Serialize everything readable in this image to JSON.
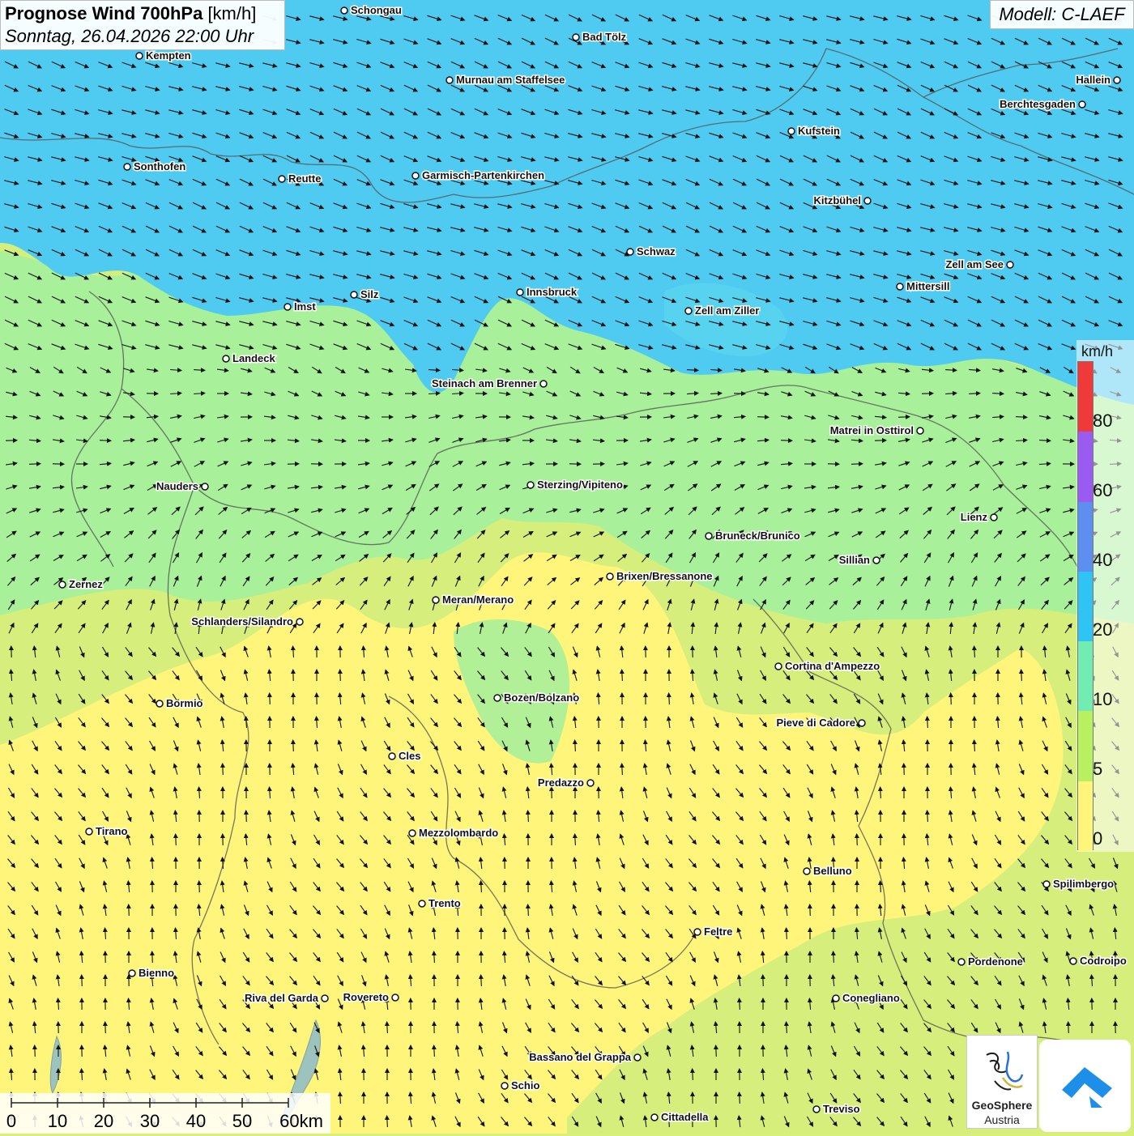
{
  "header": {
    "title": "Prognose Wind 700hPa",
    "unit": "[km/h]",
    "datetime": "Sonntag, 26.04.2026 22:00 Uhr",
    "model": "Modell: C-LAEF"
  },
  "legend": {
    "unit": "km/h",
    "labels": [
      "80",
      "60",
      "40",
      "20",
      "10",
      "5",
      "0"
    ],
    "colors": [
      "#f03a3a",
      "#9a5cf0",
      "#5c8ff0",
      "#30c4f4",
      "#72ecb0",
      "#b8f060",
      "#fff57a"
    ]
  },
  "scalebar": {
    "labels": [
      "0",
      "10",
      "20",
      "30",
      "40",
      "50",
      "60km"
    ]
  },
  "logos": {
    "geosphere_line1": "GeoSphere",
    "geosphere_line2": "Austria"
  },
  "cities": [
    {
      "name": "Schongau"
    },
    {
      "name": "Bad Tölz"
    },
    {
      "name": "Kempten"
    },
    {
      "name": "Murnau am Staffelsee"
    },
    {
      "name": "Hallein"
    },
    {
      "name": "Berchtesgaden"
    },
    {
      "name": "Kufstein"
    },
    {
      "name": "Sonthofen"
    },
    {
      "name": "Reutte"
    },
    {
      "name": "Garmisch-Partenkirchen"
    },
    {
      "name": "Kitzbühel"
    },
    {
      "name": "Schwaz"
    },
    {
      "name": "Zell am See"
    },
    {
      "name": "Mittersill"
    },
    {
      "name": "Innsbruck"
    },
    {
      "name": "Silz"
    },
    {
      "name": "Imst"
    },
    {
      "name": "Zell am Ziller"
    },
    {
      "name": "Landeck"
    },
    {
      "name": "Steinach am Brenner"
    },
    {
      "name": "Matrei in Osttirol"
    },
    {
      "name": "Nauders"
    },
    {
      "name": "Sterzing/Vipiteno"
    },
    {
      "name": "Lienz"
    },
    {
      "name": "Bruneck/Brunico"
    },
    {
      "name": "Sillian"
    },
    {
      "name": "Brixen/Bressanone"
    },
    {
      "name": "Zernez"
    },
    {
      "name": "Meran/Merano"
    },
    {
      "name": "Schlanders/Silandro"
    },
    {
      "name": "Cortina d'Ampezzo"
    },
    {
      "name": "Bozen/Bolzano"
    },
    {
      "name": "Bormio"
    },
    {
      "name": "Pieve di Cadore"
    },
    {
      "name": "Cles"
    },
    {
      "name": "Predazzo"
    },
    {
      "name": "Tirano"
    },
    {
      "name": "Mezzolombardo"
    },
    {
      "name": "Belluno"
    },
    {
      "name": "Spilimbergo"
    },
    {
      "name": "Trento"
    },
    {
      "name": "Feltre"
    },
    {
      "name": "Pordenone"
    },
    {
      "name": "Codroipo"
    },
    {
      "name": "Bienno"
    },
    {
      "name": "Riva del Garda"
    },
    {
      "name": "Rovereto"
    },
    {
      "name": "Conegliano"
    },
    {
      "name": "Bassano del Grappa"
    },
    {
      "name": "Schio"
    },
    {
      "name": "Treviso"
    },
    {
      "name": "Cittadella"
    }
  ]
}
